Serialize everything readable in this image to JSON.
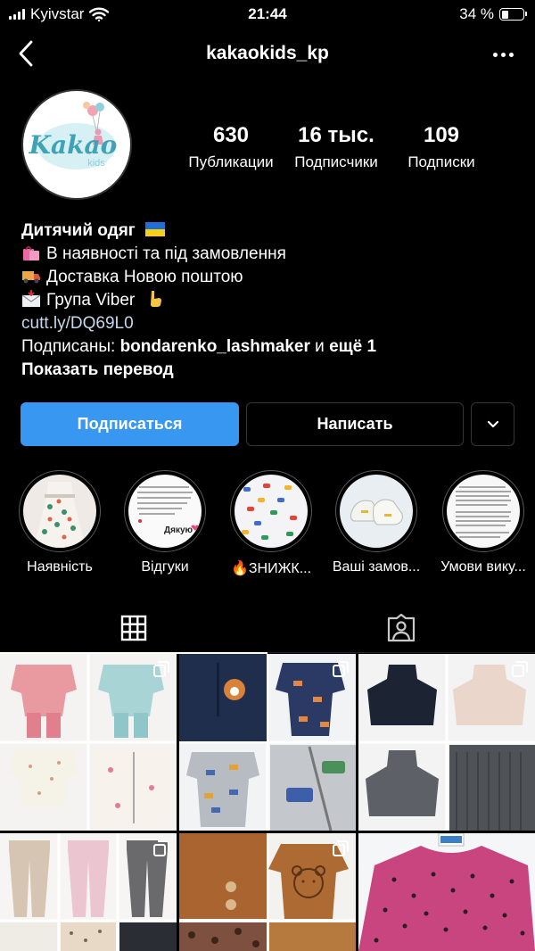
{
  "status_bar": {
    "carrier": "Kyivstar",
    "time": "21:44",
    "battery": "34 %",
    "battery_level": 0.34
  },
  "nav": {
    "username": "kakaokids_kp"
  },
  "profile": {
    "logo_text": "Kakao",
    "logo_sub": "kids",
    "stats": [
      {
        "value": "630",
        "label": "Публикации"
      },
      {
        "value": "16 тыс.",
        "label": "Подписчики"
      },
      {
        "value": "109",
        "label": "Подписки"
      }
    ]
  },
  "bio": {
    "name": "Дитячий одяг",
    "line1": "В наявності та під замовлення",
    "line2": "Доставка Новою поштою",
    "line3": "Група Viber",
    "link": "cutt.ly/DQ69L0",
    "followed_prefix": "Подписаны:",
    "followed_user": "bondarenko_lashmaker",
    "followed_mid": "и",
    "followed_more": "ещё 1",
    "translate": "Показать перевод"
  },
  "buttons": {
    "follow": "Подписаться",
    "message": "Написать"
  },
  "highlights": [
    {
      "label": "Наявність"
    },
    {
      "label": "Відгуки",
      "sticker_text": "Дякую"
    },
    {
      "label": "🔥ЗНИЖК..."
    },
    {
      "label": "Ваші замов..."
    },
    {
      "label": "Умови вику..."
    }
  ],
  "colors": {
    "accent": "#3897f0",
    "background": "#000000"
  }
}
